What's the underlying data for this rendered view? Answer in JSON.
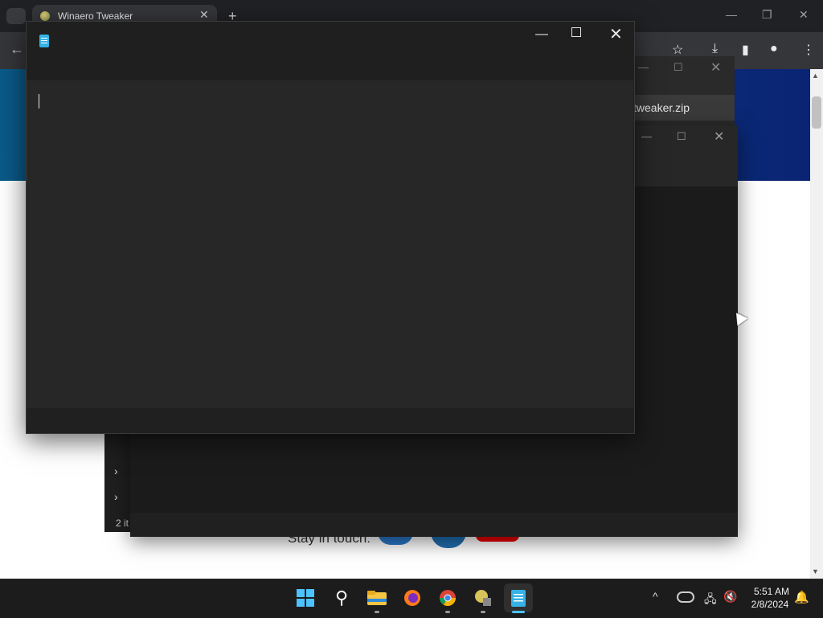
{
  "chrome": {
    "tab_title": "Winaero Tweaker",
    "tab_close": "✕",
    "new_tab": "+",
    "window_controls": {
      "minimize": "—",
      "restore": "❐",
      "close": "✕"
    },
    "toolbar_icons": {
      "back": "←",
      "bookmark": "☆",
      "download": "⤓",
      "sidebar": "▮",
      "profile": "●",
      "menu": "⋮"
    },
    "page": {
      "footer_text": "Stay in touch:"
    },
    "download_popup": {
      "file_text": "tweaker.zip",
      "controls": {
        "minimize": "—",
        "maximize": "☐",
        "close": "✕"
      }
    }
  },
  "explorer_background": {
    "chevrons": [
      "›",
      "›"
    ],
    "status": "2 it",
    "controls": {
      "minimize": "—",
      "maximize": "☐",
      "close": "✕"
    }
  },
  "notepad": {
    "controls": {
      "minimize": "—",
      "maximize": "",
      "close": "✕"
    },
    "icon": "notepad-icon"
  },
  "taskbar": {
    "icons": [
      "start-icon",
      "search-icon",
      "file-explorer-icon",
      "firefox-icon",
      "chrome-icon",
      "winaero-tweaker-icon",
      "notepad-icon"
    ],
    "search_glyph": "⚲",
    "tray": {
      "chevron": "^",
      "network": "🖧",
      "volume": "🔇",
      "time": "5:51 AM",
      "date": "2/8/2024",
      "bell": "🔔"
    }
  },
  "colors": {
    "accent": "#4cc2ff",
    "notepad_bg": "#272727",
    "taskbar_bg": "#1c1c1c"
  }
}
